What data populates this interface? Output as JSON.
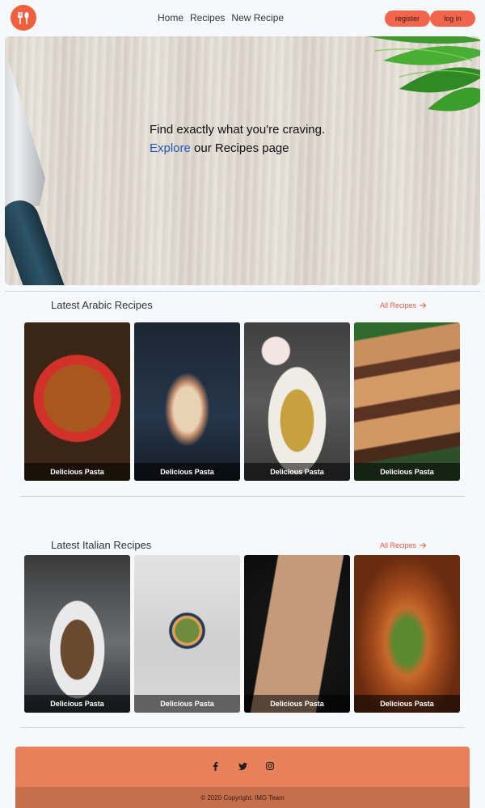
{
  "nav": {
    "logo_icon": "cutlery-icon",
    "links": [
      "Home",
      "Recipes",
      "New Recipe"
    ],
    "register_label": "register",
    "login_label": "log in",
    "accent": "#f0654b"
  },
  "hero": {
    "line1": "Find exactly what you're craving.",
    "explore_link": "Explore",
    "line2_rest": " our Recipes page"
  },
  "arabic": {
    "title": "Latest Arabic Recipes",
    "all_link": "All Recipes",
    "cards": [
      {
        "caption": "Delicious Pasta"
      },
      {
        "caption": "Delicious Pasta"
      },
      {
        "caption": "Delicious Pasta"
      },
      {
        "caption": "Delicious Pasta"
      }
    ]
  },
  "italian": {
    "title": "Latest Italian Recipes",
    "all_link": "All Recipes",
    "cards": [
      {
        "caption": "Delicious Pasta"
      },
      {
        "caption": "Delicious Pasta"
      },
      {
        "caption": "Delicious Pasta"
      },
      {
        "caption": "Delicious Pasta"
      }
    ]
  },
  "footer": {
    "social_icons": [
      "facebook-icon",
      "twitter-icon",
      "instagram-icon"
    ],
    "copyright": "© 2020 Copyright: IMG Team",
    "color": "#e8805a"
  }
}
